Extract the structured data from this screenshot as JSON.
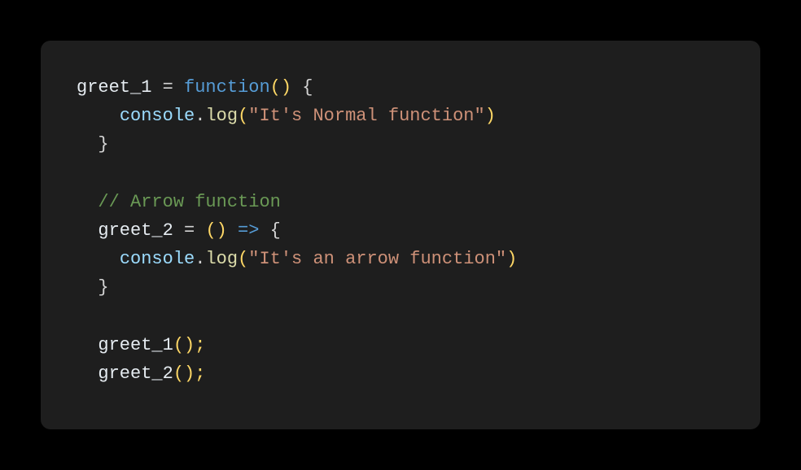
{
  "code": {
    "line1": {
      "ident": "greet_1",
      "assign": " = ",
      "keyword": "function",
      "parens": "()",
      "brace": " {"
    },
    "line2": {
      "indent": "    ",
      "obj": "console",
      "dot": ".",
      "method": "log",
      "open": "(",
      "string": "\"It's Normal function\"",
      "close": ")"
    },
    "line3": {
      "indent": "  ",
      "brace": "}"
    },
    "line5": {
      "indent": "  ",
      "comment": "// Arrow function"
    },
    "line6": {
      "indent": "  ",
      "ident": "greet_2",
      "assign": " = ",
      "parens": "()",
      "arrow": " => ",
      "brace": "{"
    },
    "line7": {
      "indent": "    ",
      "obj": "console",
      "dot": ".",
      "method": "log",
      "open": "(",
      "string": "\"It's an arrow function\"",
      "close": ")"
    },
    "line8": {
      "indent": "  ",
      "brace": "}"
    },
    "line10": {
      "indent": "  ",
      "ident": "greet_1",
      "parens": "();"
    },
    "line11": {
      "indent": "  ",
      "ident": "greet_2",
      "parens": "();"
    }
  }
}
